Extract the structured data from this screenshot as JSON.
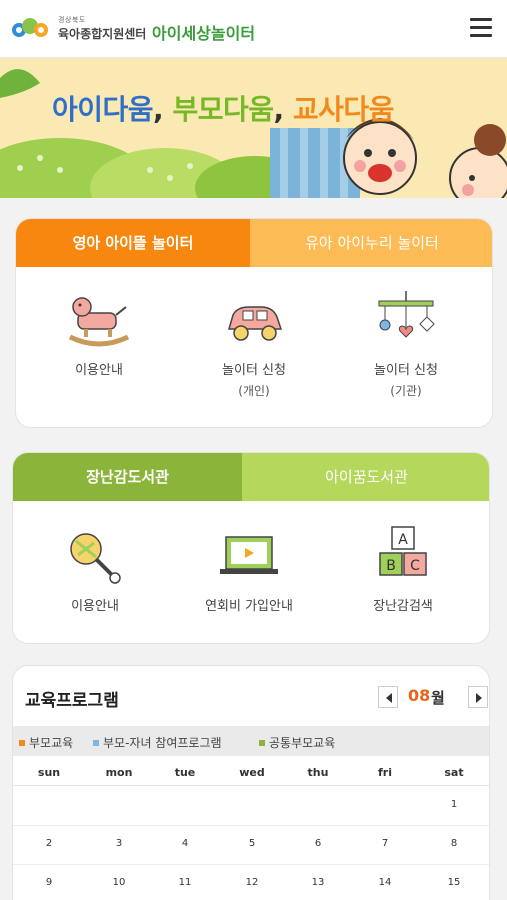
{
  "header": {
    "region": "경상북도",
    "center_name": "육아종합지원센터",
    "site_name": "아이세상놀이터",
    "icons": {
      "logo": "seal-logo-icon",
      "menu": "hamburger-menu-icon"
    }
  },
  "banner": {
    "part1": "아이다움",
    "sep": ",",
    "part2": "부모다움",
    "part3": "교사다움",
    "colors": {
      "blue": "#2f6fc8",
      "green": "#77b829",
      "orange": "#f08a1c"
    }
  },
  "playground": {
    "tabs": [
      "영아 아이뜰 놀이터",
      "유아 아이누리 놀이터"
    ],
    "items": [
      {
        "label": "이용안내",
        "sub": "",
        "icon": "rocking-horse-icon"
      },
      {
        "label": "놀이터 신청",
        "sub": "(개인)",
        "icon": "toy-car-icon"
      },
      {
        "label": "놀이터 신청",
        "sub": "(기관)",
        "icon": "mobile-toy-icon"
      }
    ],
    "colors": {
      "active": "#f7870f",
      "inactive": "#fdbb56"
    }
  },
  "library": {
    "tabs": [
      "장난감도서관",
      "아이꿈도서관"
    ],
    "items": [
      {
        "label": "이용안내",
        "icon": "rattle-icon"
      },
      {
        "label": "연회비 가입안내",
        "icon": "laptop-video-icon"
      },
      {
        "label": "장난감검색",
        "icon": "abc-blocks-icon"
      }
    ],
    "colors": {
      "active": "#8ab43a",
      "inactive": "#b5d75b"
    }
  },
  "program": {
    "title": "교육프로그램",
    "month": "08",
    "month_unit": "월",
    "legend": [
      {
        "label": "부모교육",
        "color": "#f08a1c"
      },
      {
        "label": "부모-자녀 참여프로그램",
        "color": "#7fb6e8"
      },
      {
        "label": "공통부모교육",
        "color": "#8ab43a"
      }
    ],
    "weekdays": [
      "sun",
      "mon",
      "tue",
      "wed",
      "thu",
      "fri",
      "sat"
    ],
    "weeks": [
      [
        "",
        "",
        "",
        "",
        "",
        "",
        "1"
      ],
      [
        "2",
        "3",
        "4",
        "5",
        "6",
        "7",
        "8"
      ],
      [
        "9",
        "10",
        "11",
        "12",
        "13",
        "14",
        "15"
      ]
    ]
  }
}
